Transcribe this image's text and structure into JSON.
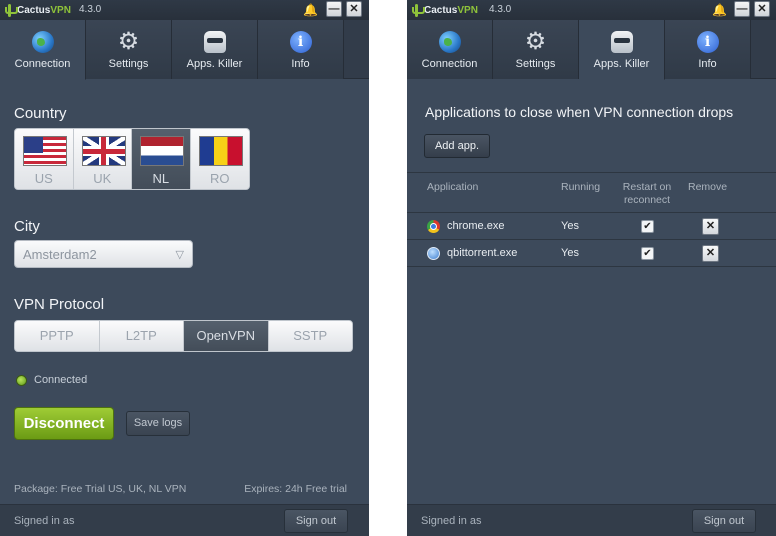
{
  "app": {
    "brand_a": "Cactus",
    "brand_b": "VPN",
    "version": "4.3.0",
    "bell_icon": "bell-icon",
    "minimize_glyph": "—",
    "close_glyph": "✕"
  },
  "tabs": [
    {
      "label": "Connection",
      "icon": "globe-icon"
    },
    {
      "label": "Settings",
      "icon": "gear-icon"
    },
    {
      "label": "Apps. Killer",
      "icon": "robot-icon"
    },
    {
      "label": "Info",
      "icon": "info-icon"
    }
  ],
  "connection": {
    "country_label": "Country",
    "countries": [
      {
        "code": "US",
        "selected": false
      },
      {
        "code": "UK",
        "selected": false
      },
      {
        "code": "NL",
        "selected": true
      },
      {
        "code": "RO",
        "selected": false
      }
    ],
    "city_label": "City",
    "city_value": "Amsterdam2",
    "protocol_label": "VPN Protocol",
    "protocols": [
      {
        "label": "PPTP",
        "selected": false
      },
      {
        "label": "L2TP",
        "selected": false
      },
      {
        "label": "OpenVPN",
        "selected": true
      },
      {
        "label": "SSTP",
        "selected": false
      }
    ],
    "status": "Connected",
    "status_color": "#8fc33a",
    "disconnect_label": "Disconnect",
    "save_logs_label": "Save logs",
    "package": "Package: Free Trial US, UK, NL VPN",
    "expires": "Expires: 24h Free trial"
  },
  "footer": {
    "signed_in": "Signed in as",
    "sign_out": "Sign out"
  },
  "apps_killer": {
    "heading": "Applications to close when VPN connection drops",
    "add_app_label": "Add app.",
    "columns": {
      "application": "Application",
      "running": "Running",
      "restart_1": "Restart on",
      "restart_2": "reconnect",
      "remove": "Remove"
    },
    "rows": [
      {
        "name": "chrome.exe",
        "icon": "chrome-icon",
        "running": "Yes",
        "restart": true
      },
      {
        "name": "qbittorrent.exe",
        "icon": "qbittorrent-icon",
        "running": "Yes",
        "restart": true
      }
    ],
    "check_glyph": "✔",
    "remove_glyph": "✕"
  }
}
